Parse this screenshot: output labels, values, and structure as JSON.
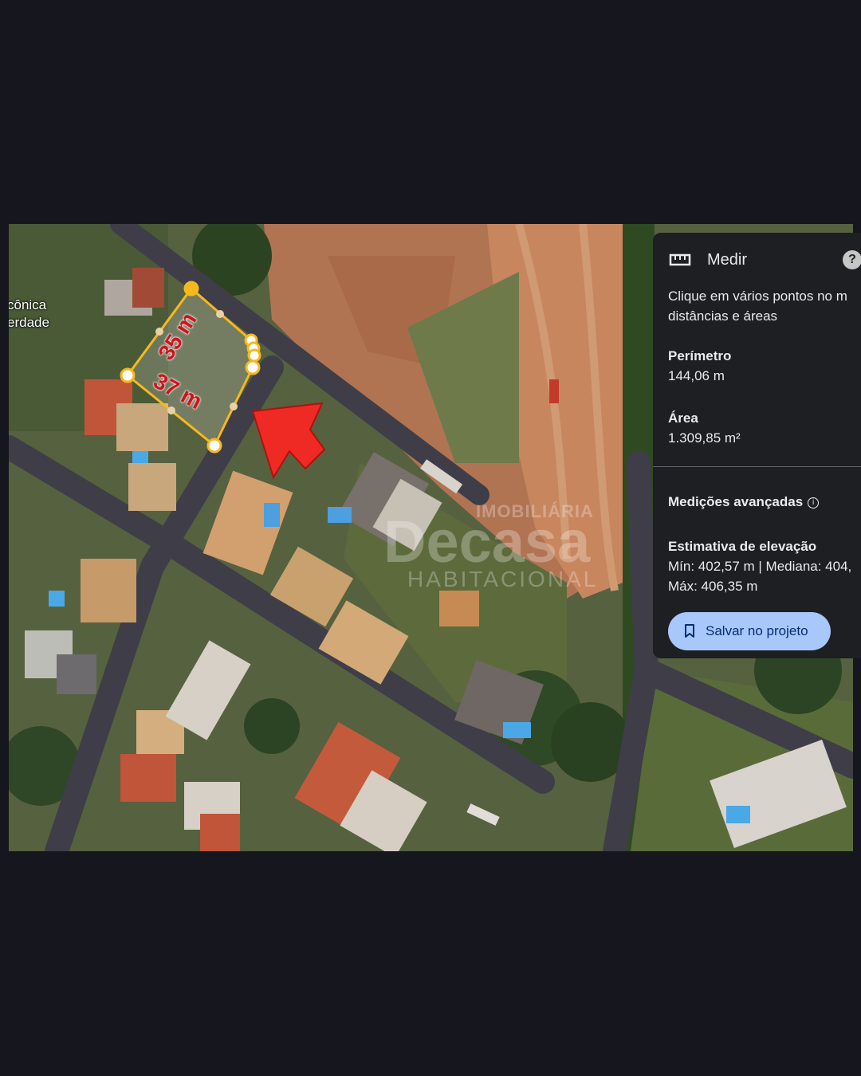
{
  "map": {
    "place_labels": [
      "cônica",
      "erdade"
    ],
    "measurements": [
      "35 m",
      "37 m"
    ],
    "watermark": {
      "line1": "IMOBILIÁRIA",
      "line2": "Decasa",
      "line3": "HABITACIONAL"
    },
    "colors": {
      "measure_outline": "#f7b81d",
      "arrow": "#ef2a24",
      "dimension_text": "#d3121c"
    }
  },
  "panel": {
    "title": "Medir",
    "title_icon": "ruler-icon",
    "help_icon": "help-icon",
    "instruction_line1": "Clique em vários pontos no m",
    "instruction_line2": "distâncias e áreas",
    "perimeter_label": "Perímetro",
    "perimeter_value": "144,06 m",
    "area_label": "Área",
    "area_value": "1.309,85 m²",
    "advanced_label": "Medições avançadas",
    "elevation_label": "Estimativa de elevação",
    "elevation_line1": "Mín: 402,57 m | Mediana: 404,",
    "elevation_line2": "Máx: 406,35 m",
    "save_button": "Salvar no projeto"
  }
}
